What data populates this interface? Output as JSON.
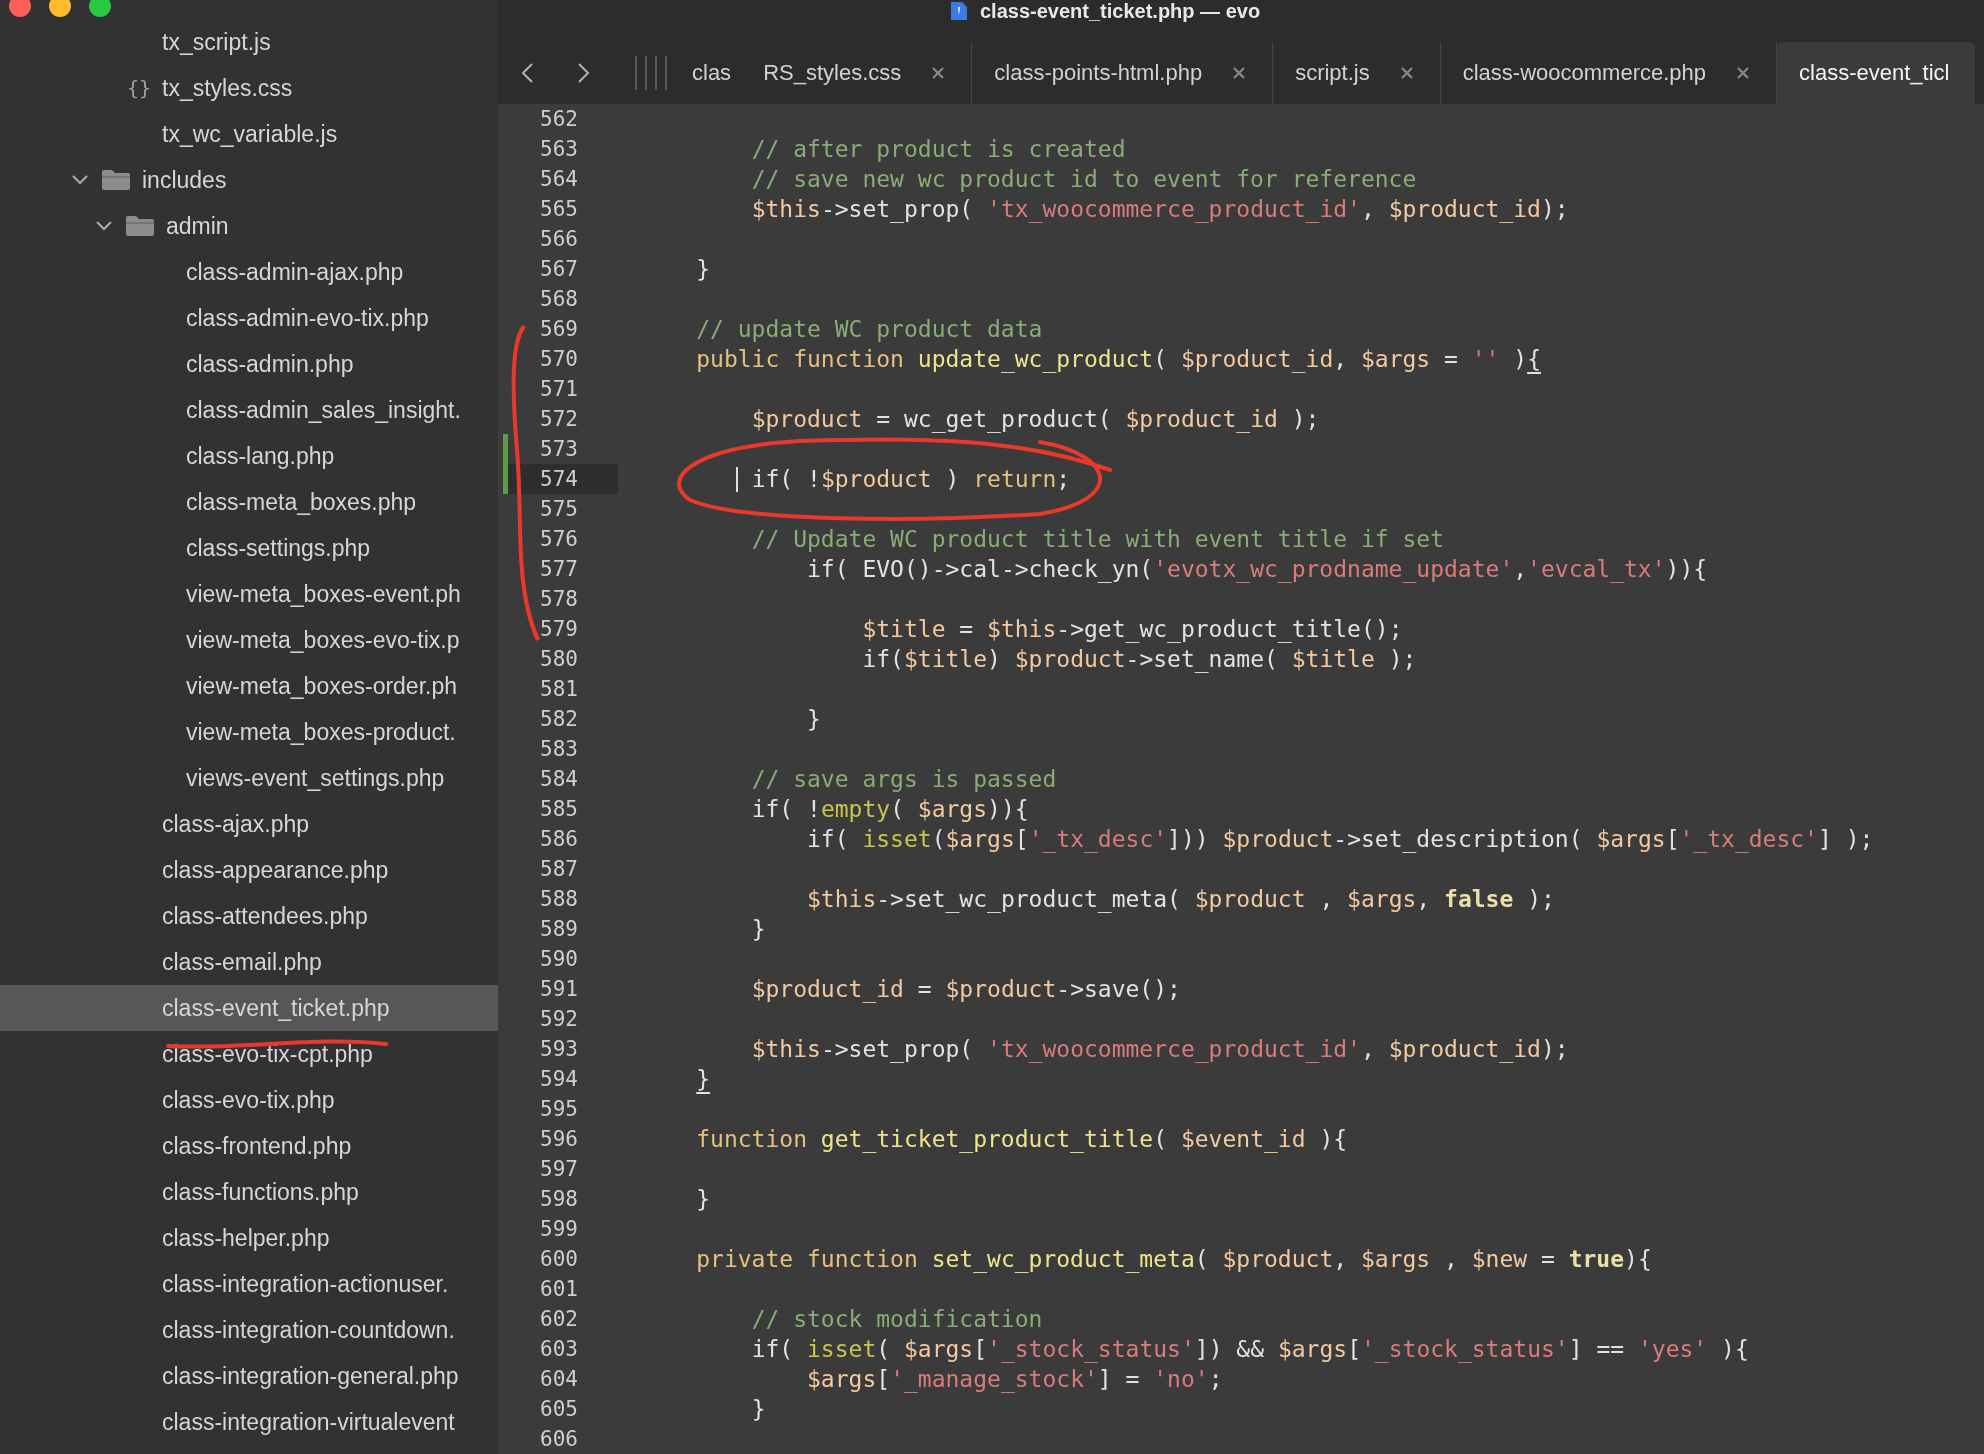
{
  "window": {
    "title": "class-event_ticket.php — evo"
  },
  "sidebar": {
    "loose_files": [
      {
        "name": "tx_script.js",
        "selected": false
      },
      {
        "name": "tx_styles.css",
        "icon": "{}",
        "selected": false
      },
      {
        "name": "tx_wc_variable.js",
        "selected": false
      }
    ],
    "tree": [
      {
        "kind": "folder",
        "name": "includes",
        "expanded": true,
        "selected": false,
        "children": [
          {
            "kind": "folder",
            "name": "admin",
            "expanded": true,
            "selected": false,
            "children": [
              {
                "kind": "file",
                "name": "class-admin-ajax.php",
                "selected": false
              },
              {
                "kind": "file",
                "name": "class-admin-evo-tix.php",
                "selected": false
              },
              {
                "kind": "file",
                "name": "class-admin.php",
                "selected": false
              },
              {
                "kind": "file",
                "name": "class-admin_sales_insight.",
                "selected": false
              },
              {
                "kind": "file",
                "name": "class-lang.php",
                "selected": false
              },
              {
                "kind": "file",
                "name": "class-meta_boxes.php",
                "selected": false
              },
              {
                "kind": "file",
                "name": "class-settings.php",
                "selected": false
              },
              {
                "kind": "file",
                "name": "view-meta_boxes-event.ph",
                "selected": false
              },
              {
                "kind": "file",
                "name": "view-meta_boxes-evo-tix.p",
                "selected": false
              },
              {
                "kind": "file",
                "name": "view-meta_boxes-order.ph",
                "selected": false
              },
              {
                "kind": "file",
                "name": "view-meta_boxes-product.",
                "selected": false
              },
              {
                "kind": "file",
                "name": "views-event_settings.php",
                "selected": false
              }
            ]
          },
          {
            "kind": "file",
            "name": "class-ajax.php",
            "selected": false
          },
          {
            "kind": "file",
            "name": "class-appearance.php",
            "selected": false
          },
          {
            "kind": "file",
            "name": "class-attendees.php",
            "selected": false
          },
          {
            "kind": "file",
            "name": "class-email.php",
            "selected": false
          },
          {
            "kind": "file",
            "name": "class-event_ticket.php",
            "selected": true
          },
          {
            "kind": "file",
            "name": "class-evo-tix-cpt.php",
            "selected": false
          },
          {
            "kind": "file",
            "name": "class-evo-tix.php",
            "selected": false
          },
          {
            "kind": "file",
            "name": "class-frontend.php",
            "selected": false
          },
          {
            "kind": "file",
            "name": "class-functions.php",
            "selected": false
          },
          {
            "kind": "file",
            "name": "class-helper.php",
            "selected": false
          },
          {
            "kind": "file",
            "name": "class-integration-actionuser.",
            "selected": false
          },
          {
            "kind": "file",
            "name": "class-integration-countdown.",
            "selected": false
          },
          {
            "kind": "file",
            "name": "class-integration-general.php",
            "selected": false
          },
          {
            "kind": "file",
            "name": "class-integration-virtualevent",
            "selected": false
          }
        ]
      }
    ]
  },
  "tabs": [
    {
      "label": "clas",
      "selected": false,
      "closable": false
    },
    {
      "label": "RS_styles.css",
      "selected": false,
      "closable": true
    },
    {
      "label": "class-points-html.php",
      "selected": false,
      "closable": true
    },
    {
      "label": "script.js",
      "selected": false,
      "closable": true
    },
    {
      "label": "class-woocommerce.php",
      "selected": false,
      "closable": true
    },
    {
      "label": "class-event_ticl",
      "selected": true,
      "closable": false
    }
  ],
  "editor": {
    "lines": [
      {
        "number": "562",
        "current": false,
        "modified": false
      },
      {
        "number": "563",
        "current": false,
        "modified": false,
        "tokens": [
          {
            "kind": "comment",
            "text": "        // after product is created"
          }
        ]
      },
      {
        "number": "564",
        "current": false,
        "modified": false,
        "tokens": [
          {
            "kind": "comment",
            "text": "        // save new wc product id to event for reference"
          }
        ]
      },
      {
        "number": "565",
        "current": false,
        "modified": false,
        "tokens": [
          {
            "kind": "var",
            "text": "        $this"
          },
          {
            "kind": "plain",
            "text": "->set_prop( "
          },
          {
            "kind": "string",
            "text": "'tx_woocommerce_product_id'"
          },
          {
            "kind": "plain",
            "text": ", "
          },
          {
            "kind": "var",
            "text": "$product_id"
          },
          {
            "kind": "plain",
            "text": ");"
          }
        ]
      },
      {
        "number": "566",
        "current": false,
        "modified": false
      },
      {
        "number": "567",
        "current": false,
        "modified": false,
        "tokens": [
          {
            "kind": "plain",
            "text": "    }"
          }
        ]
      },
      {
        "number": "568",
        "current": false,
        "modified": false
      },
      {
        "number": "569",
        "current": false,
        "modified": false,
        "tokens": [
          {
            "kind": "comment",
            "text": "    // update WC product data"
          }
        ]
      },
      {
        "number": "570",
        "current": false,
        "modified": false,
        "tokens": [
          {
            "kind": "keyword",
            "text": "    public function "
          },
          {
            "kind": "func",
            "text": "update_wc_product"
          },
          {
            "kind": "plain",
            "text": "( "
          },
          {
            "kind": "var",
            "text": "$product_id"
          },
          {
            "kind": "plain",
            "text": ", "
          },
          {
            "kind": "var",
            "text": "$args"
          },
          {
            "kind": "plain",
            "text": " = "
          },
          {
            "kind": "string",
            "text": "''"
          },
          {
            "kind": "plain",
            "text": " )"
          },
          {
            "kind": "bracket_match",
            "text": "{"
          }
        ]
      },
      {
        "number": "571",
        "current": false,
        "modified": false
      },
      {
        "number": "572",
        "current": false,
        "modified": false,
        "tokens": [
          {
            "kind": "var",
            "text": "        $product"
          },
          {
            "kind": "plain",
            "text": " = wc_get_product( "
          },
          {
            "kind": "var",
            "text": "$product_id"
          },
          {
            "kind": "plain",
            "text": " );"
          }
        ]
      },
      {
        "number": "573",
        "current": false,
        "modified": true
      },
      {
        "number": "574",
        "current": true,
        "modified": true,
        "tokens": [
          {
            "kind": "plain",
            "text": "        if( !"
          },
          {
            "kind": "var",
            "text": "$product"
          },
          {
            "kind": "plain",
            "text": " ) "
          },
          {
            "kind": "keyword",
            "text": "return"
          },
          {
            "kind": "plain",
            "text": ";"
          }
        ]
      },
      {
        "number": "575",
        "current": false,
        "modified": false
      },
      {
        "number": "576",
        "current": false,
        "modified": false,
        "tokens": [
          {
            "kind": "comment",
            "text": "        // Update WC product title with event title if set"
          }
        ]
      },
      {
        "number": "577",
        "current": false,
        "modified": false,
        "tokens": [
          {
            "kind": "plain",
            "text": "            if( EVO()->cal->check_yn("
          },
          {
            "kind": "string",
            "text": "'evotx_wc_prodname_update'"
          },
          {
            "kind": "plain",
            "text": ","
          },
          {
            "kind": "string",
            "text": "'evcal_tx'"
          },
          {
            "kind": "plain",
            "text": ")){"
          }
        ]
      },
      {
        "number": "578",
        "current": false,
        "modified": false
      },
      {
        "number": "579",
        "current": false,
        "modified": false,
        "tokens": [
          {
            "kind": "var",
            "text": "                $title"
          },
          {
            "kind": "plain",
            "text": " = "
          },
          {
            "kind": "var",
            "text": "$this"
          },
          {
            "kind": "plain",
            "text": "->get_wc_product_title();"
          }
        ]
      },
      {
        "number": "580",
        "current": false,
        "modified": false,
        "tokens": [
          {
            "kind": "plain",
            "text": "                if("
          },
          {
            "kind": "var",
            "text": "$title"
          },
          {
            "kind": "plain",
            "text": ") "
          },
          {
            "kind": "var",
            "text": "$product"
          },
          {
            "kind": "plain",
            "text": "->set_name( "
          },
          {
            "kind": "var",
            "text": "$title"
          },
          {
            "kind": "plain",
            "text": " );"
          }
        ]
      },
      {
        "number": "581",
        "current": false,
        "modified": false
      },
      {
        "number": "582",
        "current": false,
        "modified": false,
        "tokens": [
          {
            "kind": "plain",
            "text": "            }"
          }
        ]
      },
      {
        "number": "583",
        "current": false,
        "modified": false
      },
      {
        "number": "584",
        "current": false,
        "modified": false,
        "tokens": [
          {
            "kind": "comment",
            "text": "        // save args is passed"
          }
        ]
      },
      {
        "number": "585",
        "current": false,
        "modified": false,
        "tokens": [
          {
            "kind": "plain",
            "text": "        if( !"
          },
          {
            "kind": "builtin",
            "text": "empty"
          },
          {
            "kind": "plain",
            "text": "( "
          },
          {
            "kind": "var",
            "text": "$args"
          },
          {
            "kind": "plain",
            "text": ")){"
          }
        ]
      },
      {
        "number": "586",
        "current": false,
        "modified": false,
        "tokens": [
          {
            "kind": "plain",
            "text": "            if( "
          },
          {
            "kind": "builtin",
            "text": "isset"
          },
          {
            "kind": "plain",
            "text": "("
          },
          {
            "kind": "var",
            "text": "$args"
          },
          {
            "kind": "plain",
            "text": "["
          },
          {
            "kind": "string",
            "text": "'_tx_desc'"
          },
          {
            "kind": "plain",
            "text": "])) "
          },
          {
            "kind": "var",
            "text": "$product"
          },
          {
            "kind": "plain",
            "text": "->set_description( "
          },
          {
            "kind": "var",
            "text": "$args"
          },
          {
            "kind": "plain",
            "text": "["
          },
          {
            "kind": "string",
            "text": "'_tx_desc'"
          },
          {
            "kind": "plain",
            "text": "] );"
          }
        ]
      },
      {
        "number": "587",
        "current": false,
        "modified": false
      },
      {
        "number": "588",
        "current": false,
        "modified": false,
        "tokens": [
          {
            "kind": "var",
            "text": "            $this"
          },
          {
            "kind": "plain",
            "text": "->set_wc_product_meta( "
          },
          {
            "kind": "var",
            "text": "$product"
          },
          {
            "kind": "plain",
            "text": " , "
          },
          {
            "kind": "var",
            "text": "$args"
          },
          {
            "kind": "plain",
            "text": ", "
          },
          {
            "kind": "bool",
            "text": "false"
          },
          {
            "kind": "plain",
            "text": " );"
          }
        ]
      },
      {
        "number": "589",
        "current": false,
        "modified": false,
        "tokens": [
          {
            "kind": "plain",
            "text": "        }"
          }
        ]
      },
      {
        "number": "590",
        "current": false,
        "modified": false
      },
      {
        "number": "591",
        "current": false,
        "modified": false,
        "tokens": [
          {
            "kind": "var",
            "text": "        $product_id"
          },
          {
            "kind": "plain",
            "text": " = "
          },
          {
            "kind": "var",
            "text": "$product"
          },
          {
            "kind": "plain",
            "text": "->save();"
          }
        ]
      },
      {
        "number": "592",
        "current": false,
        "modified": false
      },
      {
        "number": "593",
        "current": false,
        "modified": false,
        "tokens": [
          {
            "kind": "var",
            "text": "        $this"
          },
          {
            "kind": "plain",
            "text": "->set_prop( "
          },
          {
            "kind": "string",
            "text": "'tx_woocommerce_product_id'"
          },
          {
            "kind": "plain",
            "text": ", "
          },
          {
            "kind": "var",
            "text": "$product_id"
          },
          {
            "kind": "plain",
            "text": ");"
          }
        ]
      },
      {
        "number": "594",
        "current": false,
        "modified": false,
        "tokens": [
          {
            "kind": "bracket_match",
            "text": "    }"
          }
        ]
      },
      {
        "number": "595",
        "current": false,
        "modified": false
      },
      {
        "number": "596",
        "current": false,
        "modified": false,
        "tokens": [
          {
            "kind": "keyword",
            "text": "    function "
          },
          {
            "kind": "func",
            "text": "get_ticket_product_title"
          },
          {
            "kind": "plain",
            "text": "( "
          },
          {
            "kind": "var",
            "text": "$event_id"
          },
          {
            "kind": "plain",
            "text": " ){"
          }
        ]
      },
      {
        "number": "597",
        "current": false,
        "modified": false
      },
      {
        "number": "598",
        "current": false,
        "modified": false,
        "tokens": [
          {
            "kind": "plain",
            "text": "    }"
          }
        ]
      },
      {
        "number": "599",
        "current": false,
        "modified": false
      },
      {
        "number": "600",
        "current": false,
        "modified": false,
        "tokens": [
          {
            "kind": "keyword",
            "text": "    private function "
          },
          {
            "kind": "func",
            "text": "set_wc_product_meta"
          },
          {
            "kind": "plain",
            "text": "( "
          },
          {
            "kind": "var",
            "text": "$product"
          },
          {
            "kind": "plain",
            "text": ", "
          },
          {
            "kind": "var",
            "text": "$args"
          },
          {
            "kind": "plain",
            "text": " , "
          },
          {
            "kind": "var",
            "text": "$new"
          },
          {
            "kind": "plain",
            "text": " = "
          },
          {
            "kind": "bool",
            "text": "true"
          },
          {
            "kind": "plain",
            "text": "){"
          }
        ]
      },
      {
        "number": "601",
        "current": false,
        "modified": false
      },
      {
        "number": "602",
        "current": false,
        "modified": false,
        "tokens": [
          {
            "kind": "comment",
            "text": "        // stock modification"
          }
        ]
      },
      {
        "number": "603",
        "current": false,
        "modified": false,
        "tokens": [
          {
            "kind": "plain",
            "text": "        if( "
          },
          {
            "kind": "builtin",
            "text": "isset"
          },
          {
            "kind": "plain",
            "text": "( "
          },
          {
            "kind": "var",
            "text": "$args"
          },
          {
            "kind": "plain",
            "text": "["
          },
          {
            "kind": "string",
            "text": "'_stock_status'"
          },
          {
            "kind": "plain",
            "text": "]) && "
          },
          {
            "kind": "var",
            "text": "$args"
          },
          {
            "kind": "plain",
            "text": "["
          },
          {
            "kind": "string",
            "text": "'_stock_status'"
          },
          {
            "kind": "plain",
            "text": "] == "
          },
          {
            "kind": "string",
            "text": "'yes'"
          },
          {
            "kind": "plain",
            "text": " ){"
          }
        ]
      },
      {
        "number": "604",
        "current": false,
        "modified": false,
        "tokens": [
          {
            "kind": "var",
            "text": "            $args"
          },
          {
            "kind": "plain",
            "text": "["
          },
          {
            "kind": "string",
            "text": "'_manage_stock'"
          },
          {
            "kind": "plain",
            "text": "] = "
          },
          {
            "kind": "string",
            "text": "'no'"
          },
          {
            "kind": "plain",
            "text": ";"
          }
        ]
      },
      {
        "number": "605",
        "current": false,
        "modified": false,
        "tokens": [
          {
            "kind": "plain",
            "text": "        }"
          }
        ]
      },
      {
        "number": "606",
        "current": false,
        "modified": false
      }
    ]
  },
  "annotations": [
    {
      "kind": "circle"
    },
    {
      "kind": "bracket"
    },
    {
      "kind": "underline"
    }
  ]
}
